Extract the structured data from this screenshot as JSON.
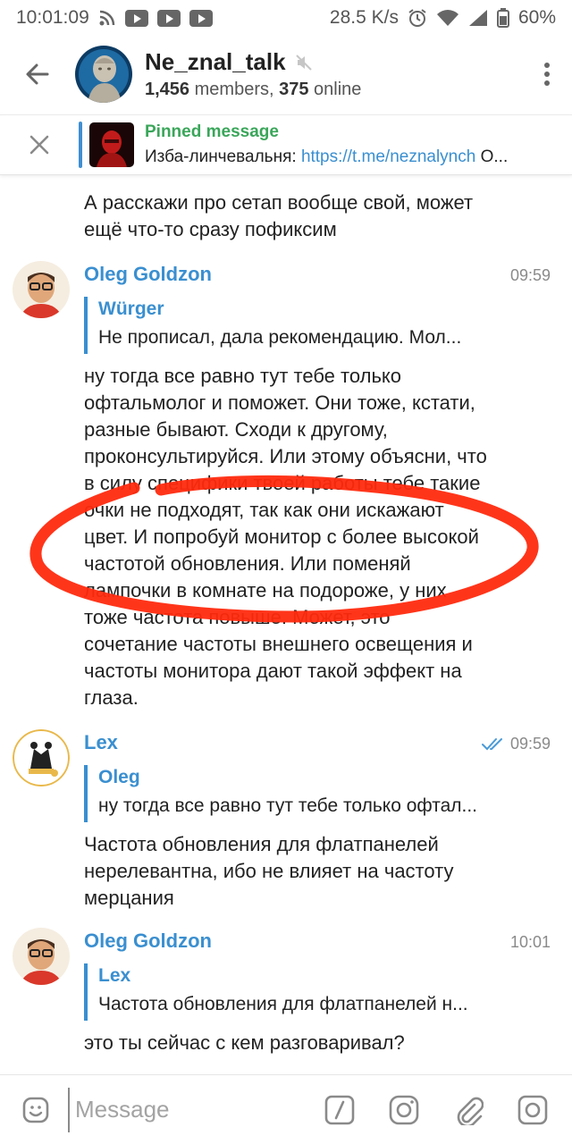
{
  "status_bar": {
    "time": "10:01:09",
    "speed": "28.5 K/s",
    "battery": "60%",
    "icons": [
      "rss-icon",
      "youtube-icon",
      "youtube-icon",
      "youtube-icon",
      "alarm-icon",
      "wifi-icon",
      "signal-icon",
      "battery-icon"
    ]
  },
  "header": {
    "title": "Ne_znal_talk",
    "members_count": "1,456",
    "members_label": "members,",
    "online_count": "375",
    "online_label": "online",
    "muted": true
  },
  "pinned": {
    "title": "Pinned message",
    "prefix": "Изба-линчевальня:",
    "link": "https://t.me/neznalynch",
    "suffix": "О..."
  },
  "messages": [
    {
      "text_lines": [
        "А расскажи про сетап вообще свой, может",
        "ещё что-то сразу пофиксим"
      ]
    },
    {
      "sender": "Oleg Goldzon",
      "time": "09:59",
      "reply_name": "Würger",
      "reply_text": "Не прописал, дала рекомендацию. Мол...",
      "text_lines": [
        "ну тогда все равно тут тебе только",
        "офтальмолог и поможет. Они тоже, кстати,",
        "разные бывают. Сходи к другому,",
        "проконсультируйся. Или этому объясни, что",
        "в силу специфики твоей работы тебе такие",
        "очки не подходят, так как они искажают",
        "цвет. И попробуй монитор с более высокой",
        "частотой обновления. Или поменяй",
        "лампочки в комнате на подороже, у них",
        "тоже частота повыше. Может, это",
        "сочетание частоты внешнего освещения и",
        "частоты монитора дают такой эффект на",
        "глаза."
      ]
    },
    {
      "sender": "Lex",
      "time": "09:59",
      "read": true,
      "reply_name": "Oleg",
      "reply_text": "ну тогда все равно тут тебе только офтал...",
      "text_lines": [
        "Частота обновления для флатпанелей",
        "нерелевантна, ибо не влияет на частоту",
        "мерцания"
      ]
    },
    {
      "sender": "Oleg Goldzon",
      "time": "10:01",
      "reply_name": "Lex",
      "reply_text": "Частота обновления для флатпанелей н...",
      "text_lines": [
        "это ты сейчас с кем разговаривал?"
      ]
    }
  ],
  "input": {
    "placeholder": "Message"
  },
  "colors": {
    "accent": "#3a8fd0",
    "pinned_green": "#3aa65a",
    "annotation_red": "#ff2a0e"
  }
}
